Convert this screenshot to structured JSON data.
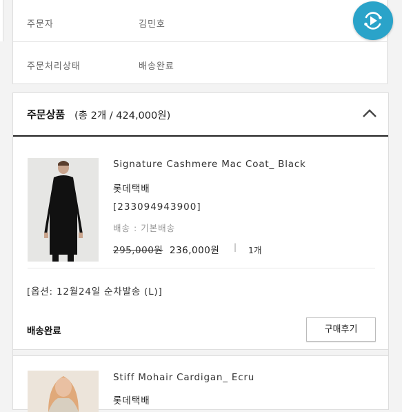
{
  "info": {
    "orderer_label": "주문자",
    "orderer_value": "김민호",
    "status_label": "주문처리상태",
    "status_value": "배송완료"
  },
  "fab": {
    "icon": "play-refresh-icon",
    "color": "#2aa3c9"
  },
  "order": {
    "title": "주문상품",
    "summary": "(총 2개 / 424,000원)",
    "collapse_icon": "chevron-up-icon"
  },
  "products": [
    {
      "name": "Signature Cashmere Mac Coat_ Black",
      "brand": "롯데택배",
      "code": "[233094943900]",
      "shipping": "배송 : 기본배송",
      "original_price": "295,000원",
      "sale_price": "236,000원",
      "separator": "|",
      "quantity": "1개",
      "option": "[옵션: 12월24일 순차발송 (L)]",
      "status": "배송완료",
      "review_button": "구매후기"
    },
    {
      "name": "Stiff Mohair Cardigan_ Ecru",
      "brand": "롯데택배"
    }
  ]
}
